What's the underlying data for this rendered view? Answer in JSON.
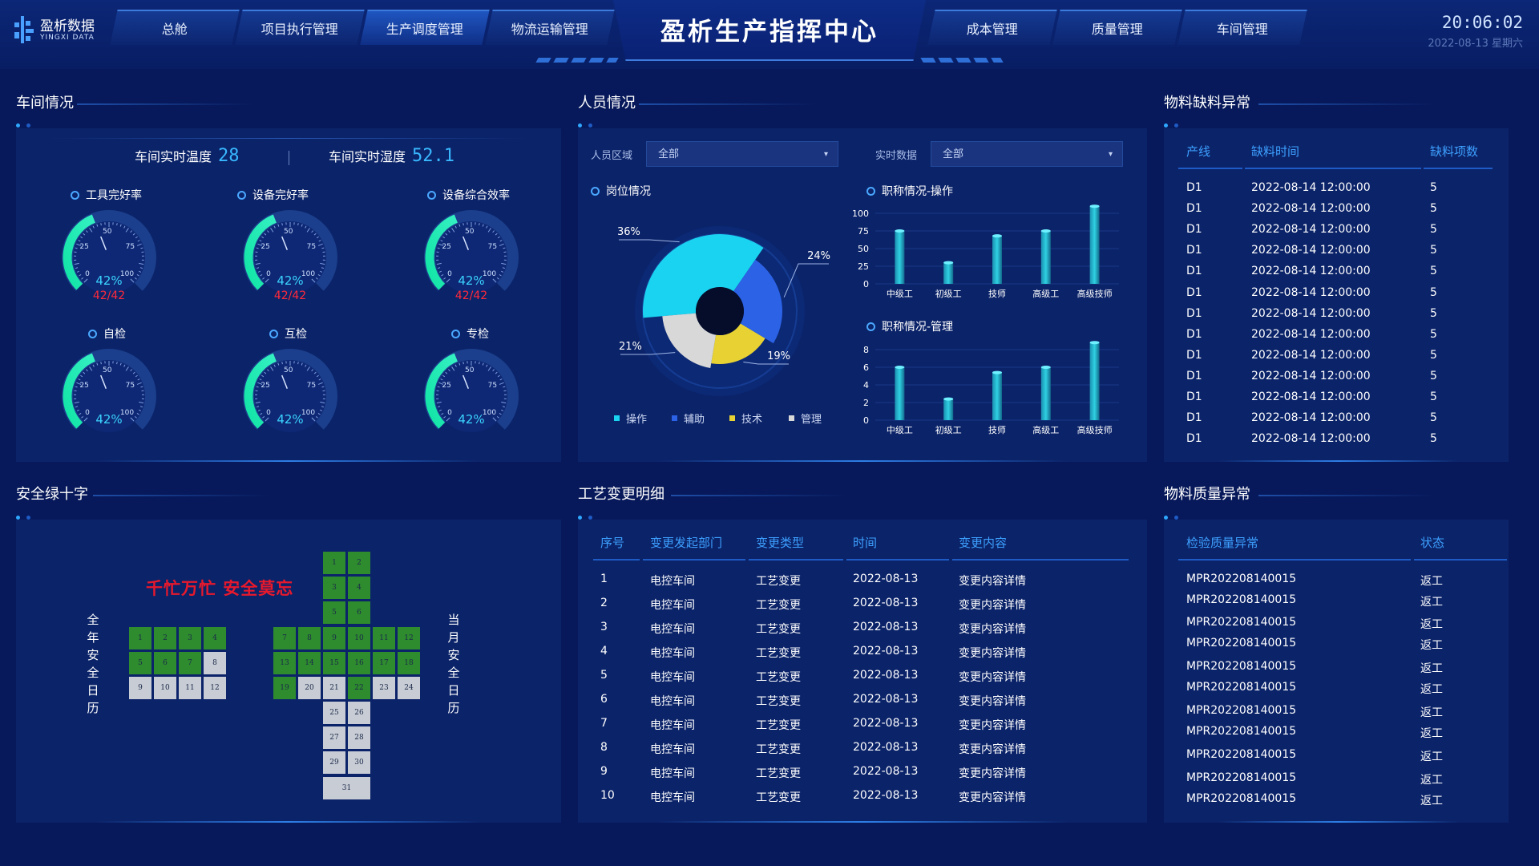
{
  "header": {
    "logo_cn": "盈析数据",
    "logo_en": "YINGXI DATA",
    "title": "盈析生产指挥中心",
    "tabs_left": [
      "总舱",
      "项目执行管理",
      "生产调度管理",
      "物流运输管理"
    ],
    "tabs_right": [
      "成本管理",
      "质量管理",
      "车间管理"
    ],
    "time": "20:06:02",
    "date": "2022-08-13 星期六"
  },
  "workshop": {
    "title": "车间情况",
    "temp_label": "车间实时温度",
    "temp_value": "28",
    "hum_label": "车间实时湿度",
    "hum_value": "52.1",
    "gauges": [
      {
        "label": "工具完好率",
        "pct": "42%",
        "ratio": "42/42",
        "value": 42
      },
      {
        "label": "设备完好率",
        "pct": "42%",
        "ratio": "42/42",
        "value": 42
      },
      {
        "label": "设备综合效率",
        "pct": "42%",
        "ratio": "42/42",
        "value": 42
      },
      {
        "label": "自检",
        "pct": "42%",
        "ratio": "",
        "value": 42
      },
      {
        "label": "互检",
        "pct": "42%",
        "ratio": "",
        "value": 42
      },
      {
        "label": "专检",
        "pct": "42%",
        "ratio": "",
        "value": 42
      }
    ],
    "gauge_ticks": [
      "0",
      "25",
      "50",
      "75",
      "100"
    ]
  },
  "personnel": {
    "title": "人员情况",
    "area_label": "人员区域",
    "area_value": "全部",
    "realtime_label": "实时数据",
    "realtime_value": "全部",
    "pie_title": "岗位情况",
    "bar1_title": "职称情况-操作",
    "bar2_title": "职称情况-管理"
  },
  "chart_data": [
    {
      "type": "pie",
      "categories": [
        "操作",
        "辅助",
        "技术",
        "管理"
      ],
      "values": [
        36,
        24,
        19,
        21
      ],
      "labels": [
        "36%",
        "24%",
        "19%",
        "21%"
      ],
      "colors": [
        "#19d3f0",
        "#2b62e6",
        "#e8d233",
        "#d8d8d8"
      ],
      "legend": "bottom"
    },
    {
      "type": "bar",
      "categories": [
        "中级工",
        "初级工",
        "技师",
        "高级工",
        "高级技师"
      ],
      "values": [
        75,
        30,
        68,
        75,
        110
      ],
      "yticks": [
        "0",
        "25",
        "50",
        "75",
        "100"
      ],
      "ylim": [
        0,
        110
      ]
    },
    {
      "type": "bar",
      "categories": [
        "中级工",
        "初级工",
        "技师",
        "高级工",
        "高级技师"
      ],
      "values": [
        6,
        2.4,
        5.4,
        6,
        8.8
      ],
      "yticks": [
        "0",
        "2",
        "4",
        "6",
        "8"
      ],
      "ylim": [
        0,
        9
      ]
    }
  ],
  "material_shortage": {
    "title": "物料缺料异常",
    "headers": [
      "产线",
      "缺料时间",
      "缺料项数"
    ],
    "rows": [
      [
        "D1",
        "2022-08-14 12:00:00",
        "5"
      ],
      [
        "D1",
        "2022-08-14 12:00:00",
        "5"
      ],
      [
        "D1",
        "2022-08-14 12:00:00",
        "5"
      ],
      [
        "D1",
        "2022-08-14 12:00:00",
        "5"
      ],
      [
        "D1",
        "2022-08-14 12:00:00",
        "5"
      ],
      [
        "D1",
        "2022-08-14 12:00:00",
        "5"
      ],
      [
        "D1",
        "2022-08-14 12:00:00",
        "5"
      ],
      [
        "D1",
        "2022-08-14 12:00:00",
        "5"
      ],
      [
        "D1",
        "2022-08-14 12:00:00",
        "5"
      ],
      [
        "D1",
        "2022-08-14 12:00:00",
        "5"
      ],
      [
        "D1",
        "2022-08-14 12:00:00",
        "5"
      ],
      [
        "D1",
        "2022-08-14 12:00:00",
        "5"
      ],
      [
        "D1",
        "2022-08-14 12:00:00",
        "5"
      ]
    ]
  },
  "safety": {
    "title": "安全绿十字",
    "slogan": "千忙万忙 安全莫忘",
    "year_label": "全年安全日历",
    "month_label": "当月安全日历",
    "year_cells": [
      "1",
      "2",
      "3",
      "4",
      "5",
      "6",
      "7",
      "8",
      "9",
      "10",
      "11",
      "12"
    ],
    "year_green": [
      1,
      2,
      3,
      4,
      5,
      6,
      7
    ],
    "month_green": [
      1,
      2,
      3,
      4,
      5,
      6,
      7,
      8,
      9,
      10,
      11,
      12,
      13,
      14,
      15,
      16,
      17,
      18,
      19,
      22
    ]
  },
  "process_change": {
    "title": "工艺变更明细",
    "headers": [
      "序号",
      "变更发起部门",
      "变更类型",
      "时间",
      "变更内容"
    ],
    "rows": [
      [
        "1",
        "电控车间",
        "工艺变更",
        "2022-08-13",
        "变更内容详情"
      ],
      [
        "2",
        "电控车间",
        "工艺变更",
        "2022-08-13",
        "变更内容详情"
      ],
      [
        "3",
        "电控车间",
        "工艺变更",
        "2022-08-13",
        "变更内容详情"
      ],
      [
        "4",
        "电控车间",
        "工艺变更",
        "2022-08-13",
        "变更内容详情"
      ],
      [
        "5",
        "电控车间",
        "工艺变更",
        "2022-08-13",
        "变更内容详情"
      ],
      [
        "6",
        "电控车间",
        "工艺变更",
        "2022-08-13",
        "变更内容详情"
      ],
      [
        "7",
        "电控车间",
        "工艺变更",
        "2022-08-13",
        "变更内容详情"
      ],
      [
        "8",
        "电控车间",
        "工艺变更",
        "2022-08-13",
        "变更内容详情"
      ],
      [
        "9",
        "电控车间",
        "工艺变更",
        "2022-08-13",
        "变更内容详情"
      ],
      [
        "10",
        "电控车间",
        "工艺变更",
        "2022-08-13",
        "变更内容详情"
      ]
    ]
  },
  "material_quality": {
    "title": "物料质量异常",
    "headers": [
      "检验质量异常",
      "状态"
    ],
    "rows": [
      [
        "MPR202208140015",
        "返工"
      ],
      [
        "MPR202208140015",
        "返工"
      ],
      [
        "MPR202208140015",
        "返工"
      ],
      [
        "MPR202208140015",
        "返工"
      ],
      [
        "MPR202208140015",
        "返工"
      ],
      [
        "MPR202208140015",
        "返工"
      ],
      [
        "MPR202208140015",
        "返工"
      ],
      [
        "MPR202208140015",
        "返工"
      ],
      [
        "MPR202208140015",
        "返工"
      ],
      [
        "MPR202208140015",
        "返工"
      ],
      [
        "MPR202208140015",
        "返工"
      ]
    ]
  }
}
